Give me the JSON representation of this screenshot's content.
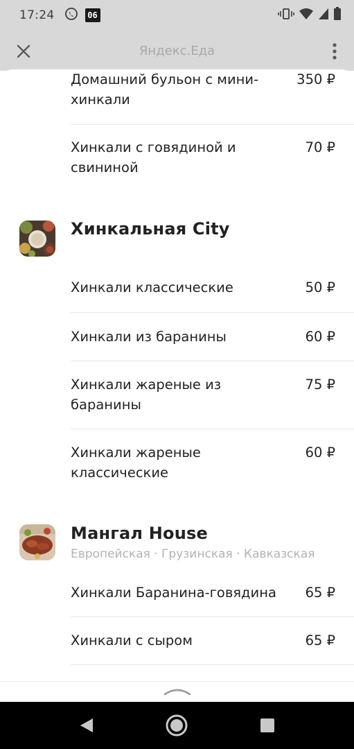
{
  "status_bar": {
    "time": "17:24",
    "badge": "06",
    "icons": [
      "viber-icon",
      "vibrate-icon",
      "wifi-icon",
      "signal-icon",
      "battery-icon"
    ]
  },
  "app_bar": {
    "title": "Яндекс.Еда",
    "close_icon": "close-icon",
    "menu_icon": "more-vertical-icon"
  },
  "sections": [
    {
      "dishes": [
        {
          "name": "Домашний бульон с мини-хинкали",
          "price": "350 ₽"
        },
        {
          "name": "Хинкали с говядиной и свининой",
          "price": "70 ₽"
        }
      ]
    },
    {
      "name": "Хинкальная City",
      "dishes": [
        {
          "name": "Хинкали классические",
          "price": "50 ₽"
        },
        {
          "name": "Хинкали из баранины",
          "price": "60 ₽"
        },
        {
          "name": "Хинкали жареные из баранины",
          "price": "75 ₽"
        },
        {
          "name": "Хинкали жареные классические",
          "price": "60 ₽"
        }
      ]
    },
    {
      "name": "Мангал House",
      "cuisine": "Европейская · Грузинская · Кавказская",
      "dishes": [
        {
          "name": "Хинкали Баранина-говядина",
          "price": "65 ₽"
        },
        {
          "name": "Хинкали с сыром",
          "price": "65 ₽"
        }
      ]
    }
  ],
  "colors": {
    "status_bar_bg": "#d8d8d8",
    "text_primary": "#222222",
    "text_muted": "#b3b3b3",
    "nav_bar_bg": "#000000"
  }
}
